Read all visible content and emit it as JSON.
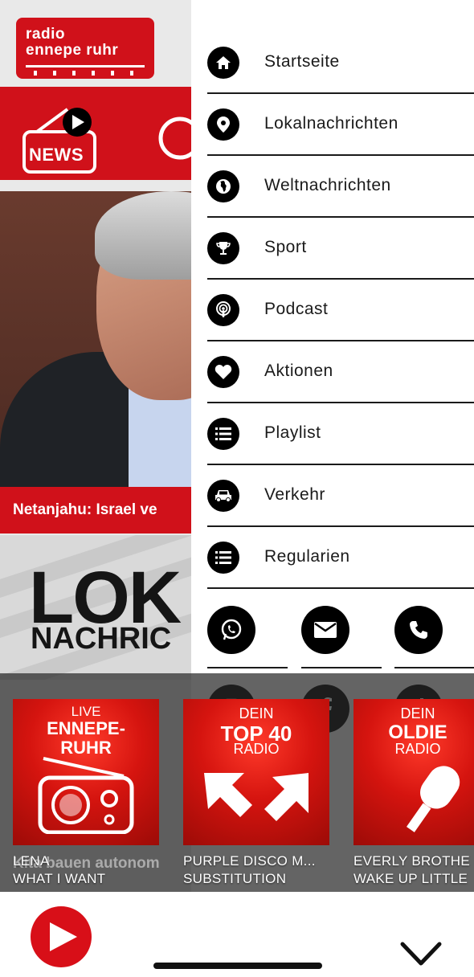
{
  "brand": {
    "line1": "radio",
    "line2": "ennepe ruhr",
    "color": "#d0111a"
  },
  "news_banner": {
    "label": "NEWS"
  },
  "featured": {
    "headline": "Netanjahu: Israel ve"
  },
  "lokal_banner": {
    "line1": "LOK",
    "line2": "NACHRIC"
  },
  "article_snippet": "Kita bauen autonom",
  "menu": {
    "items": [
      {
        "label": "Startseite",
        "icon": "home-icon"
      },
      {
        "label": "Lokalnachrichten",
        "icon": "map-pin-icon"
      },
      {
        "label": "Weltnachrichten",
        "icon": "globe-icon"
      },
      {
        "label": "Sport",
        "icon": "trophy-icon"
      },
      {
        "label": "Podcast",
        "icon": "podcast-icon"
      },
      {
        "label": "Aktionen",
        "icon": "heart-icon"
      },
      {
        "label": "Playlist",
        "icon": "list-icon"
      },
      {
        "label": "Verkehr",
        "icon": "car-icon"
      },
      {
        "label": "Regularien",
        "icon": "list-icon"
      }
    ],
    "social": [
      "whatsapp-icon",
      "email-icon",
      "phone-icon",
      "instagram-icon",
      "facebook-icon",
      "tiktok-icon"
    ]
  },
  "stations": [
    {
      "badge_top": "LIVE",
      "badge_main": "ENNEPE-",
      "badge_main2": "RUHR",
      "artist": "LENA",
      "title": "WHAT I WANT"
    },
    {
      "badge_top": "DEIN",
      "badge_main": "TOP 40",
      "badge_sub": "RADIO",
      "artist": "PURPLE DISCO M...",
      "title": "SUBSTITUTION"
    },
    {
      "badge_top": "DEIN",
      "badge_main": "OLDIE",
      "badge_sub": "RADIO",
      "artist": "EVERLY BROTHE",
      "title": "WAKE UP LITTLE"
    }
  ],
  "player": {
    "accent": "#d80f18"
  }
}
